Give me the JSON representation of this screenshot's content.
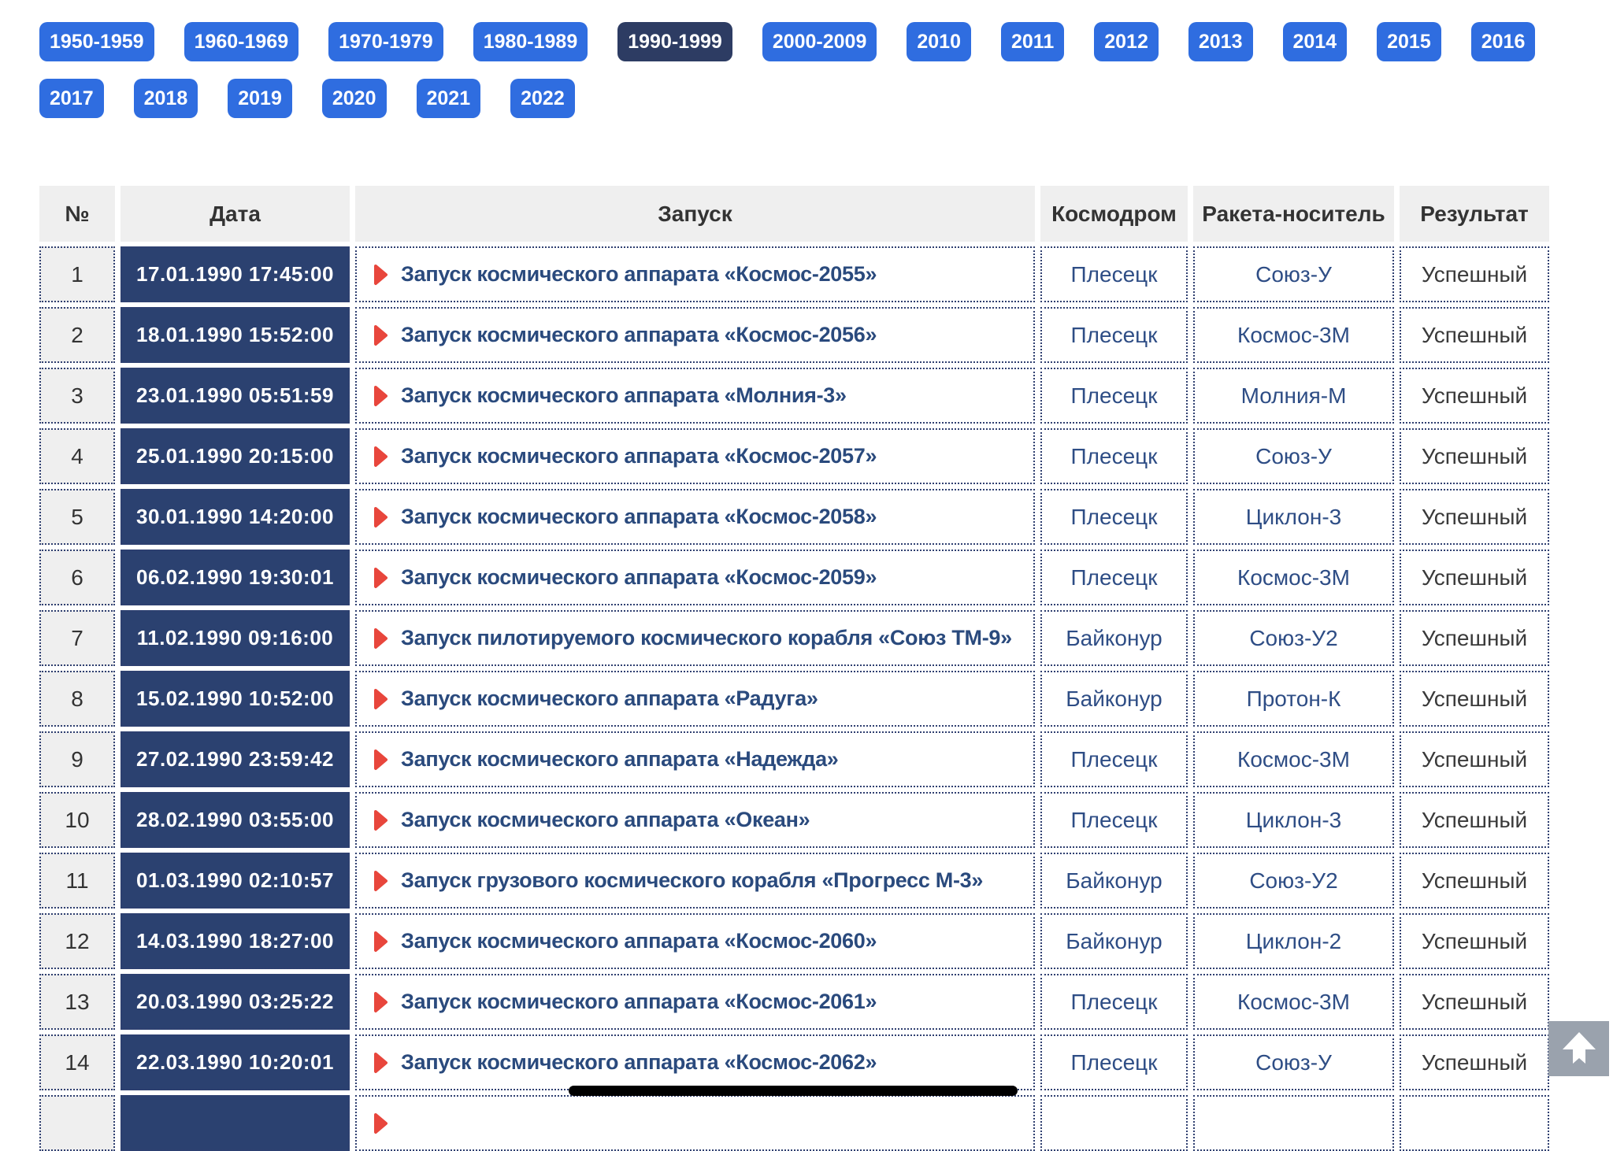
{
  "filters": {
    "selected": "1990-1999",
    "buttons": [
      "1950-1959",
      "1960-1969",
      "1970-1979",
      "1980-1989",
      "1990-1999",
      "2000-2009",
      "2010",
      "2011",
      "2012",
      "2013",
      "2014",
      "2015",
      "2016",
      "2017",
      "2018",
      "2019",
      "2020",
      "2021",
      "2022"
    ]
  },
  "table": {
    "headers": [
      "№",
      "Дата",
      "Запуск",
      "Космодром",
      "Ракета-носитель",
      "Результат"
    ],
    "rows": [
      {
        "num": "1",
        "date": "17.01.1990 17:45:00",
        "launch": "Запуск космического аппарата «Космос-2055»",
        "site": "Плесецк",
        "rocket": "Союз-У",
        "result": "Успешный"
      },
      {
        "num": "2",
        "date": "18.01.1990 15:52:00",
        "launch": "Запуск космического аппарата «Космос-2056»",
        "site": "Плесецк",
        "rocket": "Космос-3М",
        "result": "Успешный"
      },
      {
        "num": "3",
        "date": "23.01.1990 05:51:59",
        "launch": "Запуск космического аппарата «Молния-3»",
        "site": "Плесецк",
        "rocket": "Молния-М",
        "result": "Успешный"
      },
      {
        "num": "4",
        "date": "25.01.1990 20:15:00",
        "launch": "Запуск космического аппарата «Космос-2057»",
        "site": "Плесецк",
        "rocket": "Союз-У",
        "result": "Успешный"
      },
      {
        "num": "5",
        "date": "30.01.1990 14:20:00",
        "launch": "Запуск космического аппарата «Космос-2058»",
        "site": "Плесецк",
        "rocket": "Циклон-3",
        "result": "Успешный"
      },
      {
        "num": "6",
        "date": "06.02.1990 19:30:01",
        "launch": "Запуск космического аппарата «Космос-2059»",
        "site": "Плесецк",
        "rocket": "Космос-3М",
        "result": "Успешный"
      },
      {
        "num": "7",
        "date": "11.02.1990 09:16:00",
        "launch": "Запуск пилотируемого космического корабля «Союз ТМ-9»",
        "site": "Байконур",
        "rocket": "Союз-У2",
        "result": "Успешный"
      },
      {
        "num": "8",
        "date": "15.02.1990 10:52:00",
        "launch": "Запуск космического аппарата «Радуга»",
        "site": "Байконур",
        "rocket": "Протон-К",
        "result": "Успешный"
      },
      {
        "num": "9",
        "date": "27.02.1990 23:59:42",
        "launch": "Запуск космического аппарата «Надежда»",
        "site": "Плесецк",
        "rocket": "Космос-3М",
        "result": "Успешный"
      },
      {
        "num": "10",
        "date": "28.02.1990 03:55:00",
        "launch": "Запуск космического аппарата «Океан»",
        "site": "Плесецк",
        "rocket": "Циклон-3",
        "result": "Успешный"
      },
      {
        "num": "11",
        "date": "01.03.1990 02:10:57",
        "launch": "Запуск грузового космического корабля «Прогресс М-3»",
        "site": "Байконур",
        "rocket": "Союз-У2",
        "result": "Успешный"
      },
      {
        "num": "12",
        "date": "14.03.1990 18:27:00",
        "launch": "Запуск космического аппарата «Космос-2060»",
        "site": "Байконур",
        "rocket": "Циклон-2",
        "result": "Успешный"
      },
      {
        "num": "13",
        "date": "20.03.1990 03:25:22",
        "launch": "Запуск космического аппарата «Космос-2061»",
        "site": "Плесецк",
        "rocket": "Космос-3М",
        "result": "Успешный"
      },
      {
        "num": "14",
        "date": "22.03.1990 10:20:01",
        "launch": "Запуск космического аппарата «Космос-2062»",
        "site": "Плесецк",
        "rocket": "Союз-У",
        "result": "Успешный"
      },
      {
        "num": "",
        "date": "",
        "launch": "",
        "site": "",
        "rocket": "",
        "result": "",
        "partial": true
      }
    ]
  },
  "icons": {
    "launch_marker": "play-triangle",
    "scroll_top": "arrow-up"
  },
  "colors": {
    "accent_blue": "#2f6de0",
    "selected_navy": "#2d3c63",
    "date_navy": "#2b4170",
    "link_navy": "#2a4a7d",
    "site_navy": "#2e4d85",
    "arrow_red": "#e8463c",
    "border_navy": "#2f3f70",
    "header_gray": "#efefef",
    "result_text": "#3a3a3a",
    "scroll_btn_gray": "#9aa2ad"
  }
}
